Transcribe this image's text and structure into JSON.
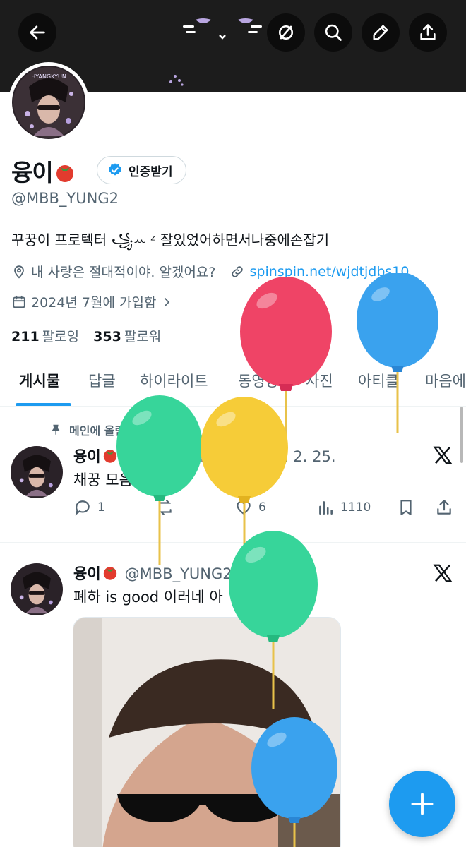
{
  "profile": {
    "display_name": "융이",
    "verify_button_label": "인증받기",
    "handle": "@MBB_YUNG2",
    "bio": "꾸꿍이 프로텍터 ꧁ꕀ ᶻ 잘있었어하면서나중에손잡기",
    "location": "내 사랑은 절대적이야. 알겠어요?",
    "website": "spinspin.net/wjdtjdbs10",
    "joined": "2024년 7월에 가입함",
    "following_count": "211",
    "following_label": "팔로잉",
    "followers_count": "353",
    "followers_label": "팔로워",
    "avatar_text": "HYANGKYUN"
  },
  "tabs": [
    {
      "label": "게시물",
      "active": true
    },
    {
      "label": "답글"
    },
    {
      "label": "하이라이트"
    },
    {
      "label": "동영상"
    },
    {
      "label": "사진"
    },
    {
      "label": "아티클"
    },
    {
      "label": "마음에"
    }
  ],
  "pinned_label": "메인에 올림",
  "posts": [
    {
      "name": "융이",
      "meta": "@MBB_YUNG2 · 2026. 2. 25.",
      "text": "채꿍 모음",
      "replies": "1",
      "likes": "6",
      "views": "1110"
    },
    {
      "name": "융이",
      "meta": "@MBB_YUNG2 · 1일",
      "text": "폐하 is good 이러네 아"
    }
  ],
  "icons": {
    "header": [
      "back-arrow-icon",
      "cat-face-icon",
      "mute-icon",
      "search-icon",
      "edit-icon",
      "share-icon"
    ],
    "fab": "plus-icon"
  },
  "colors": {
    "accent": "#1d9bf0",
    "text": "#0f1419",
    "secondary": "#536471",
    "banner": "#1c1c1c",
    "balloon_red": "#ef4466",
    "balloon_blue": "#3aa2ee",
    "balloon_green": "#37d59a",
    "balloon_yellow": "#f6cc38"
  }
}
